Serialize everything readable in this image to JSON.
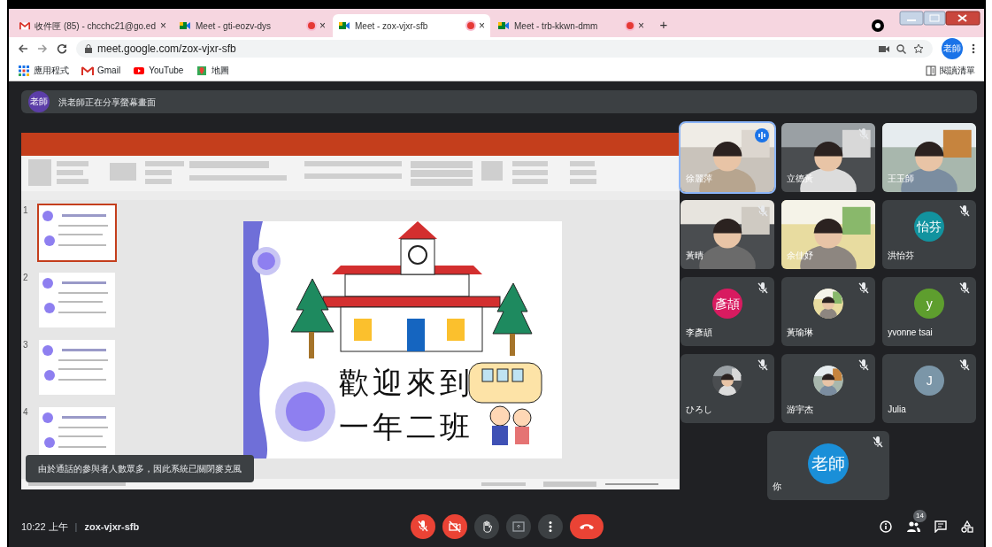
{
  "browser": {
    "tabs": [
      {
        "title": "收件匣 (85) - chcchc21@go.ed",
        "kind": "gmail",
        "recording": false,
        "selected": false,
        "close": "×"
      },
      {
        "title": "Meet - gti-eozv-dys",
        "kind": "meet",
        "recording": true,
        "selected": false,
        "close": "×"
      },
      {
        "title": "Meet - zox-vjxr-sfb",
        "kind": "meet",
        "recording": true,
        "selected": true,
        "close": "×"
      },
      {
        "title": "Meet - trb-kkwn-dmm",
        "kind": "meet",
        "recording": true,
        "selected": false,
        "close": "×"
      }
    ],
    "new_tab": "+",
    "url": "meet.google.com/zox-vjxr-sfb",
    "profile": "老師",
    "bookmarks": [
      {
        "label": "應用程式",
        "kind": "apps"
      },
      {
        "label": "Gmail",
        "kind": "gmail"
      },
      {
        "label": "YouTube",
        "kind": "youtube"
      },
      {
        "label": "地圖",
        "kind": "maps"
      }
    ],
    "reading_list": "閱讀清單"
  },
  "meet": {
    "banner": {
      "avatar": "老師",
      "text": "洪老師正在分享螢幕畫面"
    },
    "presentation": {
      "slides": [
        {
          "number": "1",
          "selected": true
        },
        {
          "number": "2",
          "selected": false
        },
        {
          "number": "3",
          "selected": false
        },
        {
          "number": "4",
          "selected": false
        }
      ],
      "slide_lines": [
        "歡迎來到",
        "一年二班"
      ]
    },
    "notice": "由於通話的參與者人數眾多，因此系統已關閉麥克風",
    "tiles": [
      {
        "name": "徐麗萍",
        "kind": "video",
        "muted": false,
        "speaking": true
      },
      {
        "name": "立德黃",
        "kind": "video",
        "muted": true,
        "speaking": false
      },
      {
        "name": "王玉師",
        "kind": "video",
        "muted": false,
        "speaking": false
      },
      {
        "name": "黃晴",
        "kind": "video",
        "muted": true,
        "speaking": false
      },
      {
        "name": "余佳妤",
        "kind": "video",
        "muted": false,
        "speaking": false
      },
      {
        "name": "洪怡芬",
        "kind": "initials",
        "avatar": "怡芬",
        "color": "#12939f",
        "muted": true,
        "speaking": false
      },
      {
        "name": "李彥頡",
        "kind": "initials",
        "avatar": "彥頡",
        "color": "#d81b60",
        "muted": true,
        "speaking": false
      },
      {
        "name": "黃瑜琳",
        "muted": true,
        "speaking": false
      },
      {
        "name": "yvonne tsai",
        "kind": "initials",
        "avatar": "y",
        "color": "#5e9e2e",
        "muted": true,
        "speaking": false
      },
      {
        "name": "ひろし",
        "muted": true,
        "speaking": false
      },
      {
        "name": "游宇杰",
        "muted": true,
        "speaking": false
      },
      {
        "name": "Julia",
        "kind": "initials",
        "avatar": "J",
        "color": "#7b96a8",
        "muted": true,
        "speaking": false
      }
    ],
    "self_tile": {
      "name": "你",
      "avatar": "老師",
      "color": "#1a8fd8",
      "muted": true
    },
    "bottom": {
      "time": "10:22 上午",
      "separator": "|",
      "code": "zox-vjxr-sfb",
      "mic_on": false,
      "camera_on": false,
      "participants_count": "14"
    }
  }
}
